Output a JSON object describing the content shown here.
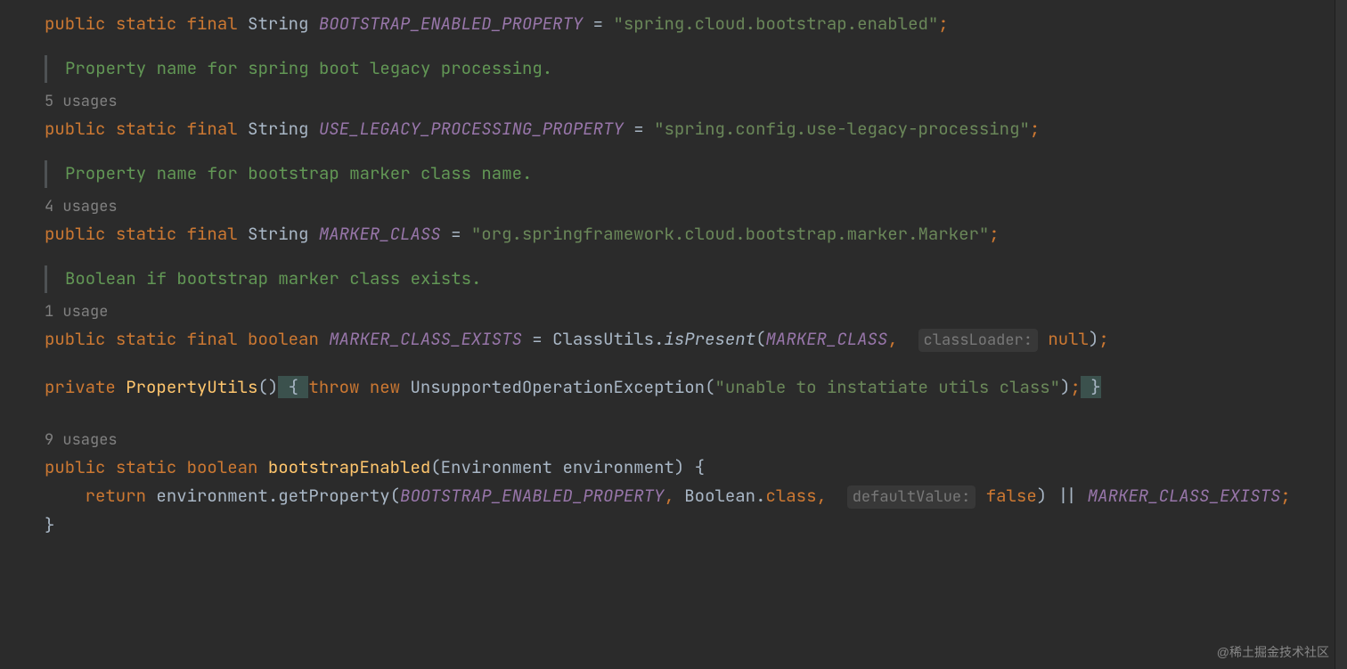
{
  "code": {
    "line1": {
      "kw1": "public",
      "kw2": "static",
      "kw3": "final",
      "type": "String",
      "const": "BOOTSTRAP_ENABLED_PROPERTY",
      "eq": " = ",
      "str": "\"spring.cloud.bootstrap.enabled\"",
      "semi": ";"
    },
    "doc1": "Property name for spring boot legacy processing.",
    "usages1": "5 usages",
    "line2": {
      "kw1": "public",
      "kw2": "static",
      "kw3": "final",
      "type": "String",
      "const": "USE_LEGACY_PROCESSING_PROPERTY",
      "eq": " = ",
      "str": "\"spring.config.use-legacy-processing\"",
      "semi": ";"
    },
    "doc2": "Property name for bootstrap marker class name.",
    "usages2": "4 usages",
    "line3": {
      "kw1": "public",
      "kw2": "static",
      "kw3": "final",
      "type": "String",
      "const": "MARKER_CLASS",
      "eq": " = ",
      "str": "\"org.springframework.cloud.bootstrap.marker.Marker\"",
      "semi": ";"
    },
    "doc3": "Boolean if bootstrap marker class exists.",
    "usages3": "1 usage",
    "line4": {
      "kw1": "public",
      "kw2": "static",
      "kw3": "final",
      "kw4": "boolean",
      "const": "MARKER_CLASS_EXISTS",
      "eq": " = ",
      "cls": "ClassUtils",
      "dot": ".",
      "method": "isPresent",
      "open": "(",
      "arg1": "MARKER_CLASS",
      "comma": ",",
      "hint": "classLoader:",
      "nullkw": "null",
      "close": ")",
      "semi": ";"
    },
    "line5": {
      "kw1": "private",
      "ctor": "PropertyUtils",
      "parens": "()",
      "open": " { ",
      "kw2": "throw",
      "kw3": "new",
      "exc": "UnsupportedOperationException",
      "paren1": "(",
      "str": "\"unable to instatiate utils class\"",
      "paren2": ")",
      "semi": ";",
      "close": " }"
    },
    "usages4": "9 usages",
    "line6": {
      "kw1": "public",
      "kw2": "static",
      "kw3": "boolean",
      "method": "bootstrapEnabled",
      "open": "(",
      "ptype": "Environment",
      "pname": "environment",
      "close": ") {"
    },
    "line7": {
      "indent": "    ",
      "kw1": "return",
      "var": "environment",
      "dot": ".",
      "method": "getProperty",
      "open": "(",
      "arg1": "BOOTSTRAP_ENABLED_PROPERTY",
      "comma1": ", ",
      "cls": "Boolean",
      "clsdot": ".",
      "clskw": "class",
      "comma2": ",",
      "hint": "defaultValue:",
      "falsekw": "false",
      "close": ")",
      "or": " || ",
      "const2": "MARKER_CLASS_EXISTS",
      "semi": ";"
    },
    "line8": {
      "close": "}"
    }
  },
  "watermark": "@稀土掘金技术社区"
}
